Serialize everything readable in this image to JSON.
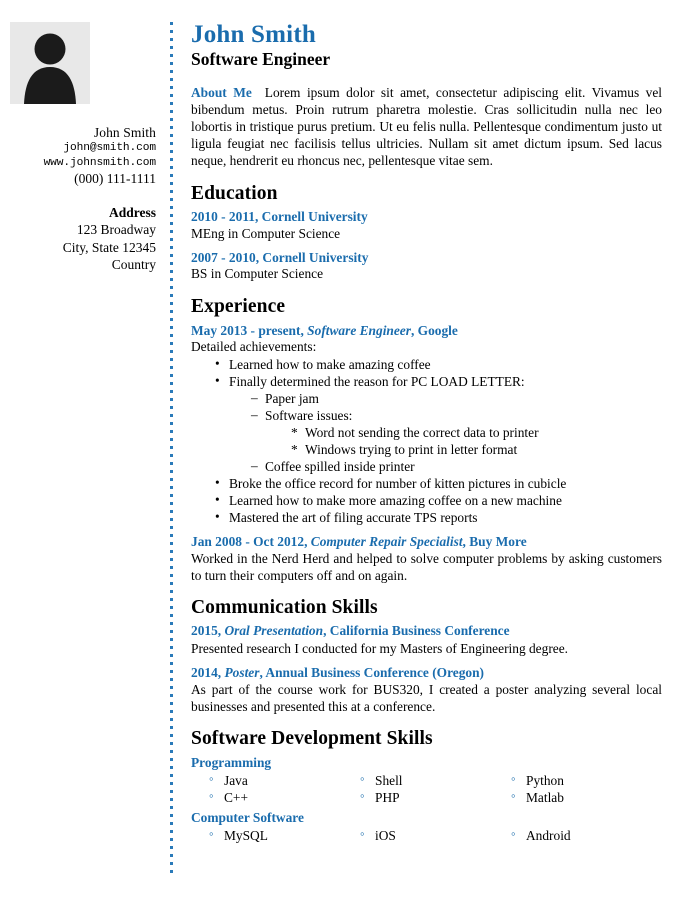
{
  "theme": {
    "accent_blue": "#1a6cad",
    "divider_blue": "#2a7ab9",
    "avatar_bg": "#e8e8e8",
    "text": "#000000"
  },
  "sidebar": {
    "avatar_icon": "person-placeholder-icon",
    "name": "John Smith",
    "email": "john@smith.com",
    "website": "www.johnsmith.com",
    "phone": "(000) 111-1111",
    "address_title": "Address",
    "address_lines": [
      "123 Broadway",
      "City, State 12345",
      "Country"
    ]
  },
  "header": {
    "full_name": "John Smith",
    "job_title": "Software Engineer"
  },
  "about": {
    "label": "About Me",
    "text": "Lorem ipsum dolor sit amet, consectetur adipiscing elit. Vivamus vel bibendum metus. Proin rutrum pharetra molestie. Cras sollicitudin nulla nec leo lobortis in tristique purus pretium. Ut eu felis nulla. Pellentesque condimentum justo ut ligula feugiat nec facilisis tellus ultricies. Nullam sit amet dictum ipsum. Sed lacus neque, hendrerit eu rhoncus nec, pellentesque vitae sem."
  },
  "education": {
    "heading": "Education",
    "entries": [
      {
        "head": "2010 - 2011, Cornell University",
        "sub": "MEng in Computer Science"
      },
      {
        "head": "2007 - 2010, Cornell University",
        "sub": "BS in Computer Science"
      }
    ]
  },
  "experience": {
    "heading": "Experience",
    "job1": {
      "date": "May 2013 - present, ",
      "role": "Software Engineer",
      "company": ", Google",
      "sub": "Detailed achievements:",
      "bullets": {
        "b1": "Learned how to make amazing coffee",
        "b2": "Finally determined the reason for PC LOAD LETTER:",
        "b2_sub1": "Paper jam",
        "b2_sub2": "Software issues:",
        "b2_sub2_a": "Word not sending the correct data to printer",
        "b2_sub2_b": "Windows trying to print in letter format",
        "b2_sub3": "Coffee spilled inside printer",
        "b3": "Broke the office record for number of kitten pictures in cubicle",
        "b4": "Learned how to make more amazing coffee on a new machine",
        "b5": "Mastered the art of filing accurate TPS reports"
      }
    },
    "job2": {
      "date": "Jan 2008 - Oct 2012, ",
      "role": "Computer Repair Specialist",
      "company": ", Buy More",
      "desc": "Worked in the Nerd Herd and helped to solve computer problems by asking customers to turn their computers off and on again."
    }
  },
  "communication": {
    "heading": "Communication Skills",
    "entries": [
      {
        "year": "2015, ",
        "kind": "Oral Presentation",
        "venue": ", California Business Conference",
        "desc": "Presented research I conducted for my Masters of Engineering degree."
      },
      {
        "year": "2014, ",
        "kind": "Poster",
        "venue": ", Annual Business Conference (Oregon)",
        "desc": "As part of the course work for BUS320, I created a poster analyzing several local businesses and presented this at a conference."
      }
    ]
  },
  "dev_skills": {
    "heading": "Software Development Skills",
    "groups": [
      {
        "title": "Programming",
        "items": [
          "Java",
          "Shell",
          "Python",
          "C++",
          "PHP",
          "Matlab"
        ]
      },
      {
        "title": "Computer Software",
        "items": [
          "MySQL",
          "iOS",
          "Android"
        ]
      }
    ]
  }
}
